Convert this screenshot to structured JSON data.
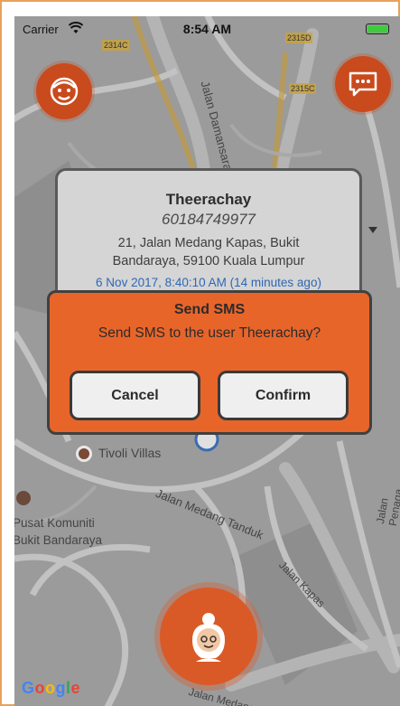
{
  "status_bar": {
    "carrier": "Carrier",
    "time": "8:54 AM"
  },
  "map": {
    "road_labels": [
      "2314C",
      "2315D",
      "2315C",
      "Jalan Damansara",
      "Jalan Medang Tanduk",
      "Jalan Penaga",
      "Jalan Kapas",
      "Jalan Medang"
    ],
    "places": [
      {
        "name": "Tivoli Villas"
      },
      {
        "name": "Pusat Komuniti",
        "name2": "Bukit Bandaraya"
      }
    ],
    "provider": "Google"
  },
  "info_card": {
    "name": "Theerachay",
    "phone": "60184749977",
    "address_line1": "21, Jalan Medang Kapas, Bukit",
    "address_line2": "Bandaraya, 59100 Kuala Lumpur",
    "timestamp": "6 Nov 2017, 8:40:10 AM (14 minutes ago)"
  },
  "dialog": {
    "title": "Send SMS",
    "message": "Send SMS to the user Theerachay?",
    "cancel_label": "Cancel",
    "confirm_label": "Confirm"
  },
  "icons": {
    "top_left": "user-avatar-icon",
    "top_right": "chat-bubble-icon",
    "bottom": "grandmother-avatar-icon",
    "wifi": "wifi-icon",
    "battery": "battery-icon"
  },
  "colors": {
    "accent": "#e8652a",
    "accent_dark": "#c94a1d",
    "link": "#2d67b5"
  }
}
